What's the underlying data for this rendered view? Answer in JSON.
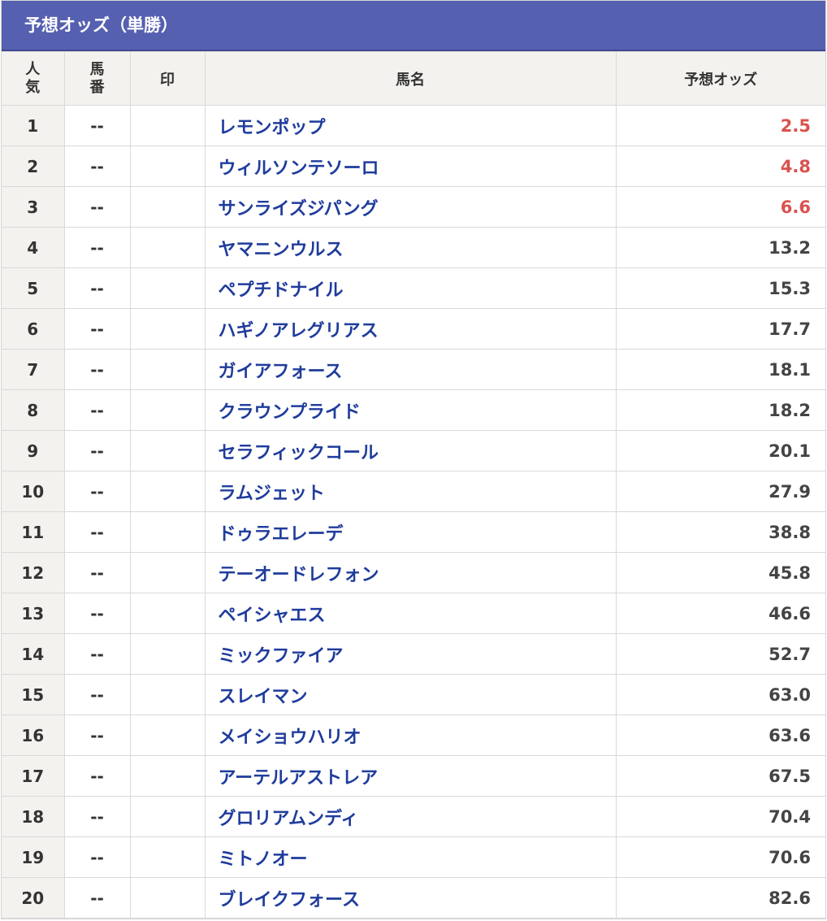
{
  "title": "予想オッズ（単勝）",
  "headers": {
    "popularity_line1": "人",
    "popularity_line2": "気",
    "number_line1": "馬",
    "number_line2": "番",
    "mark": "印",
    "horse_name": "馬名",
    "odds": "予想オッズ"
  },
  "colors": {
    "header_bar": "#5660b0",
    "horse_name": "#1f3c9c",
    "hot_odds": "#d9534f",
    "header_bg": "#f3f2ee"
  },
  "rows": [
    {
      "rank": "1",
      "number": "--",
      "mark": "",
      "name": "レモンポップ",
      "odds": "2.5",
      "hot": true
    },
    {
      "rank": "2",
      "number": "--",
      "mark": "",
      "name": "ウィルソンテソーロ",
      "odds": "4.8",
      "hot": true
    },
    {
      "rank": "3",
      "number": "--",
      "mark": "",
      "name": "サンライズジパング",
      "odds": "6.6",
      "hot": true
    },
    {
      "rank": "4",
      "number": "--",
      "mark": "",
      "name": "ヤマニンウルス",
      "odds": "13.2",
      "hot": false
    },
    {
      "rank": "5",
      "number": "--",
      "mark": "",
      "name": "ペプチドナイル",
      "odds": "15.3",
      "hot": false
    },
    {
      "rank": "6",
      "number": "--",
      "mark": "",
      "name": "ハギノアレグリアス",
      "odds": "17.7",
      "hot": false
    },
    {
      "rank": "7",
      "number": "--",
      "mark": "",
      "name": "ガイアフォース",
      "odds": "18.1",
      "hot": false
    },
    {
      "rank": "8",
      "number": "--",
      "mark": "",
      "name": "クラウンプライド",
      "odds": "18.2",
      "hot": false
    },
    {
      "rank": "9",
      "number": "--",
      "mark": "",
      "name": "セラフィックコール",
      "odds": "20.1",
      "hot": false
    },
    {
      "rank": "10",
      "number": "--",
      "mark": "",
      "name": "ラムジェット",
      "odds": "27.9",
      "hot": false
    },
    {
      "rank": "11",
      "number": "--",
      "mark": "",
      "name": "ドゥラエレーデ",
      "odds": "38.8",
      "hot": false
    },
    {
      "rank": "12",
      "number": "--",
      "mark": "",
      "name": "テーオードレフォン",
      "odds": "45.8",
      "hot": false
    },
    {
      "rank": "13",
      "number": "--",
      "mark": "",
      "name": "ペイシャエス",
      "odds": "46.6",
      "hot": false
    },
    {
      "rank": "14",
      "number": "--",
      "mark": "",
      "name": "ミックファイア",
      "odds": "52.7",
      "hot": false
    },
    {
      "rank": "15",
      "number": "--",
      "mark": "",
      "name": "スレイマン",
      "odds": "63.0",
      "hot": false
    },
    {
      "rank": "16",
      "number": "--",
      "mark": "",
      "name": "メイショウハリオ",
      "odds": "63.6",
      "hot": false
    },
    {
      "rank": "17",
      "number": "--",
      "mark": "",
      "name": "アーテルアストレア",
      "odds": "67.5",
      "hot": false
    },
    {
      "rank": "18",
      "number": "--",
      "mark": "",
      "name": "グロリアムンディ",
      "odds": "70.4",
      "hot": false
    },
    {
      "rank": "19",
      "number": "--",
      "mark": "",
      "name": "ミトノオー",
      "odds": "70.6",
      "hot": false
    },
    {
      "rank": "20",
      "number": "--",
      "mark": "",
      "name": "ブレイクフォース",
      "odds": "82.6",
      "hot": false
    }
  ]
}
